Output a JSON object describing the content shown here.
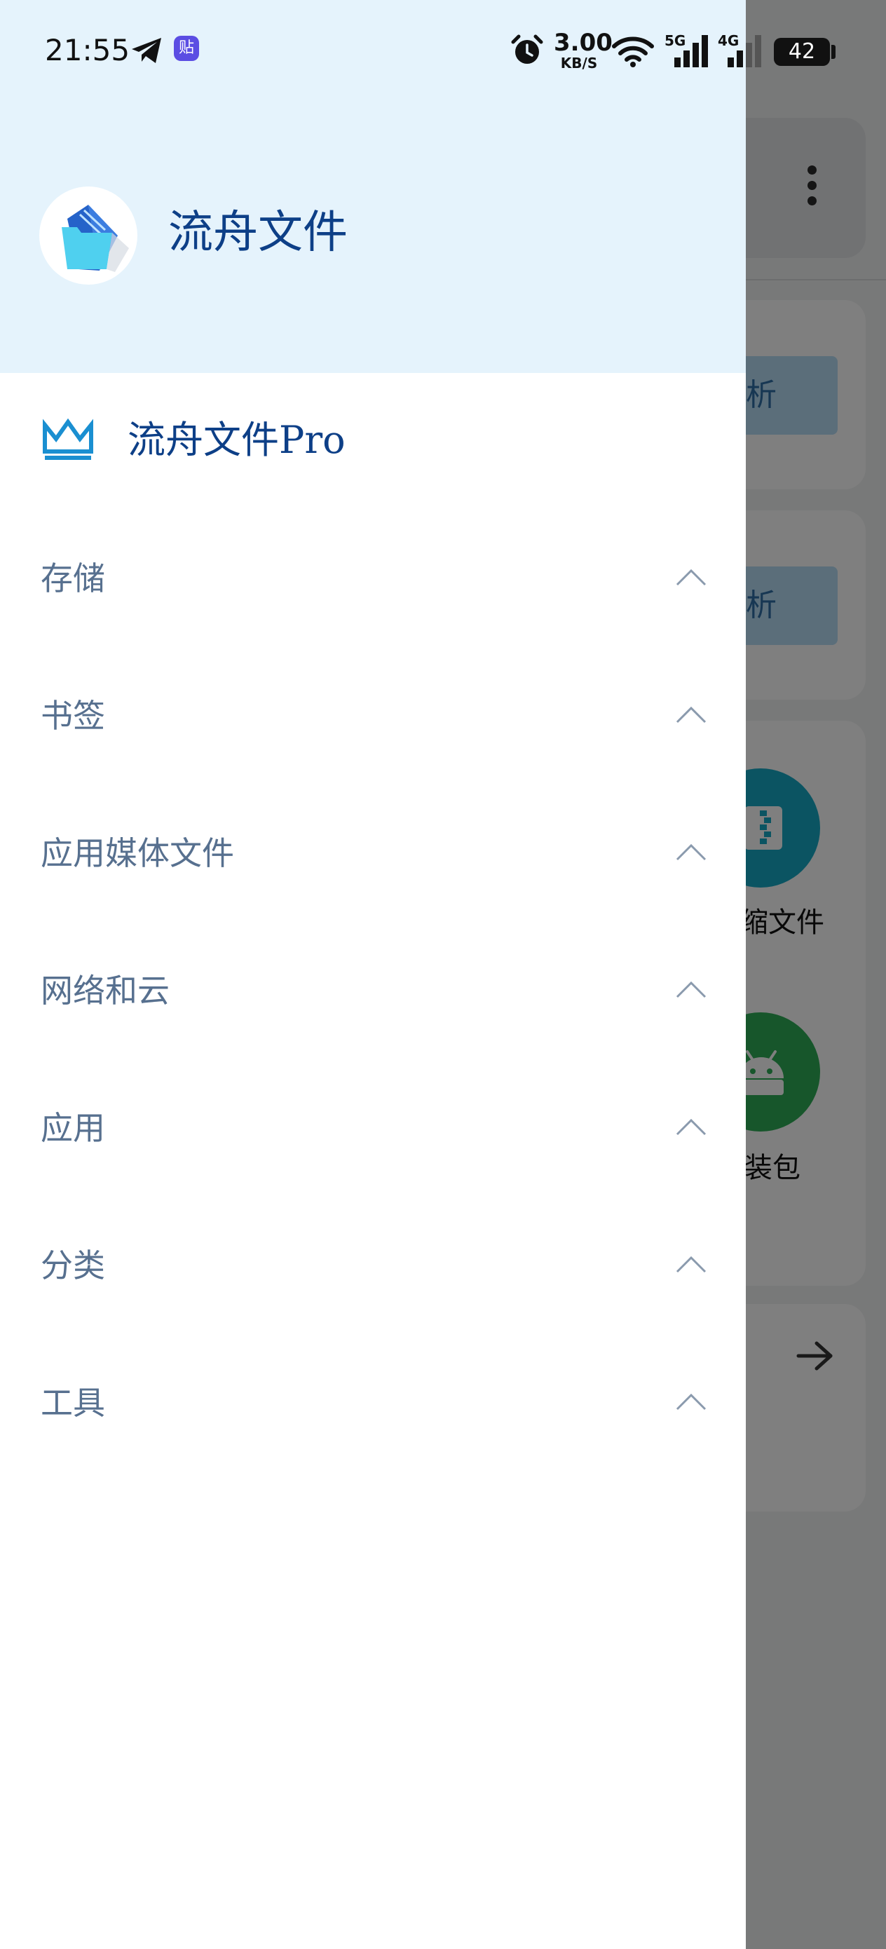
{
  "status_bar": {
    "time": "21:55",
    "tieba_glyph": "贴",
    "net_speed_value": "3.00",
    "net_speed_unit": "KB/S",
    "sim1_network": "5G",
    "sim2_network": "4G",
    "battery_level": "42",
    "icons": [
      "telegram-icon",
      "tieba-icon",
      "alarm-icon",
      "wifi-icon",
      "cell-signal-icon",
      "battery-icon"
    ]
  },
  "drawer": {
    "app_name": "流舟文件",
    "pro": {
      "label": "流舟文件Pro",
      "icon": "crown-icon"
    },
    "sections": [
      {
        "label": "存储",
        "icon": "chevron-up-icon",
        "expanded": true
      },
      {
        "label": "书签",
        "icon": "chevron-up-icon",
        "expanded": true
      },
      {
        "label": "应用媒体文件",
        "icon": "chevron-up-icon",
        "expanded": true
      },
      {
        "label": "网络和云",
        "icon": "chevron-up-icon",
        "expanded": true
      },
      {
        "label": "应用",
        "icon": "chevron-up-icon",
        "expanded": true
      },
      {
        "label": "分类",
        "icon": "chevron-up-icon",
        "expanded": true
      },
      {
        "label": "工具",
        "icon": "chevron-up-icon",
        "expanded": true
      }
    ]
  },
  "background": {
    "button_1_partial": "析",
    "button_2_partial": "析",
    "category_1_partial": "缩文件",
    "category_2_partial": "装包",
    "icons": [
      "more-vert-icon",
      "archive-icon",
      "android-icon",
      "arrow-right-icon"
    ]
  },
  "colors": {
    "drawer_header_bg": "#e5f3fc",
    "primary_text": "#0d3f87",
    "section_text": "#57708f",
    "crown": "#1a8fd1"
  }
}
